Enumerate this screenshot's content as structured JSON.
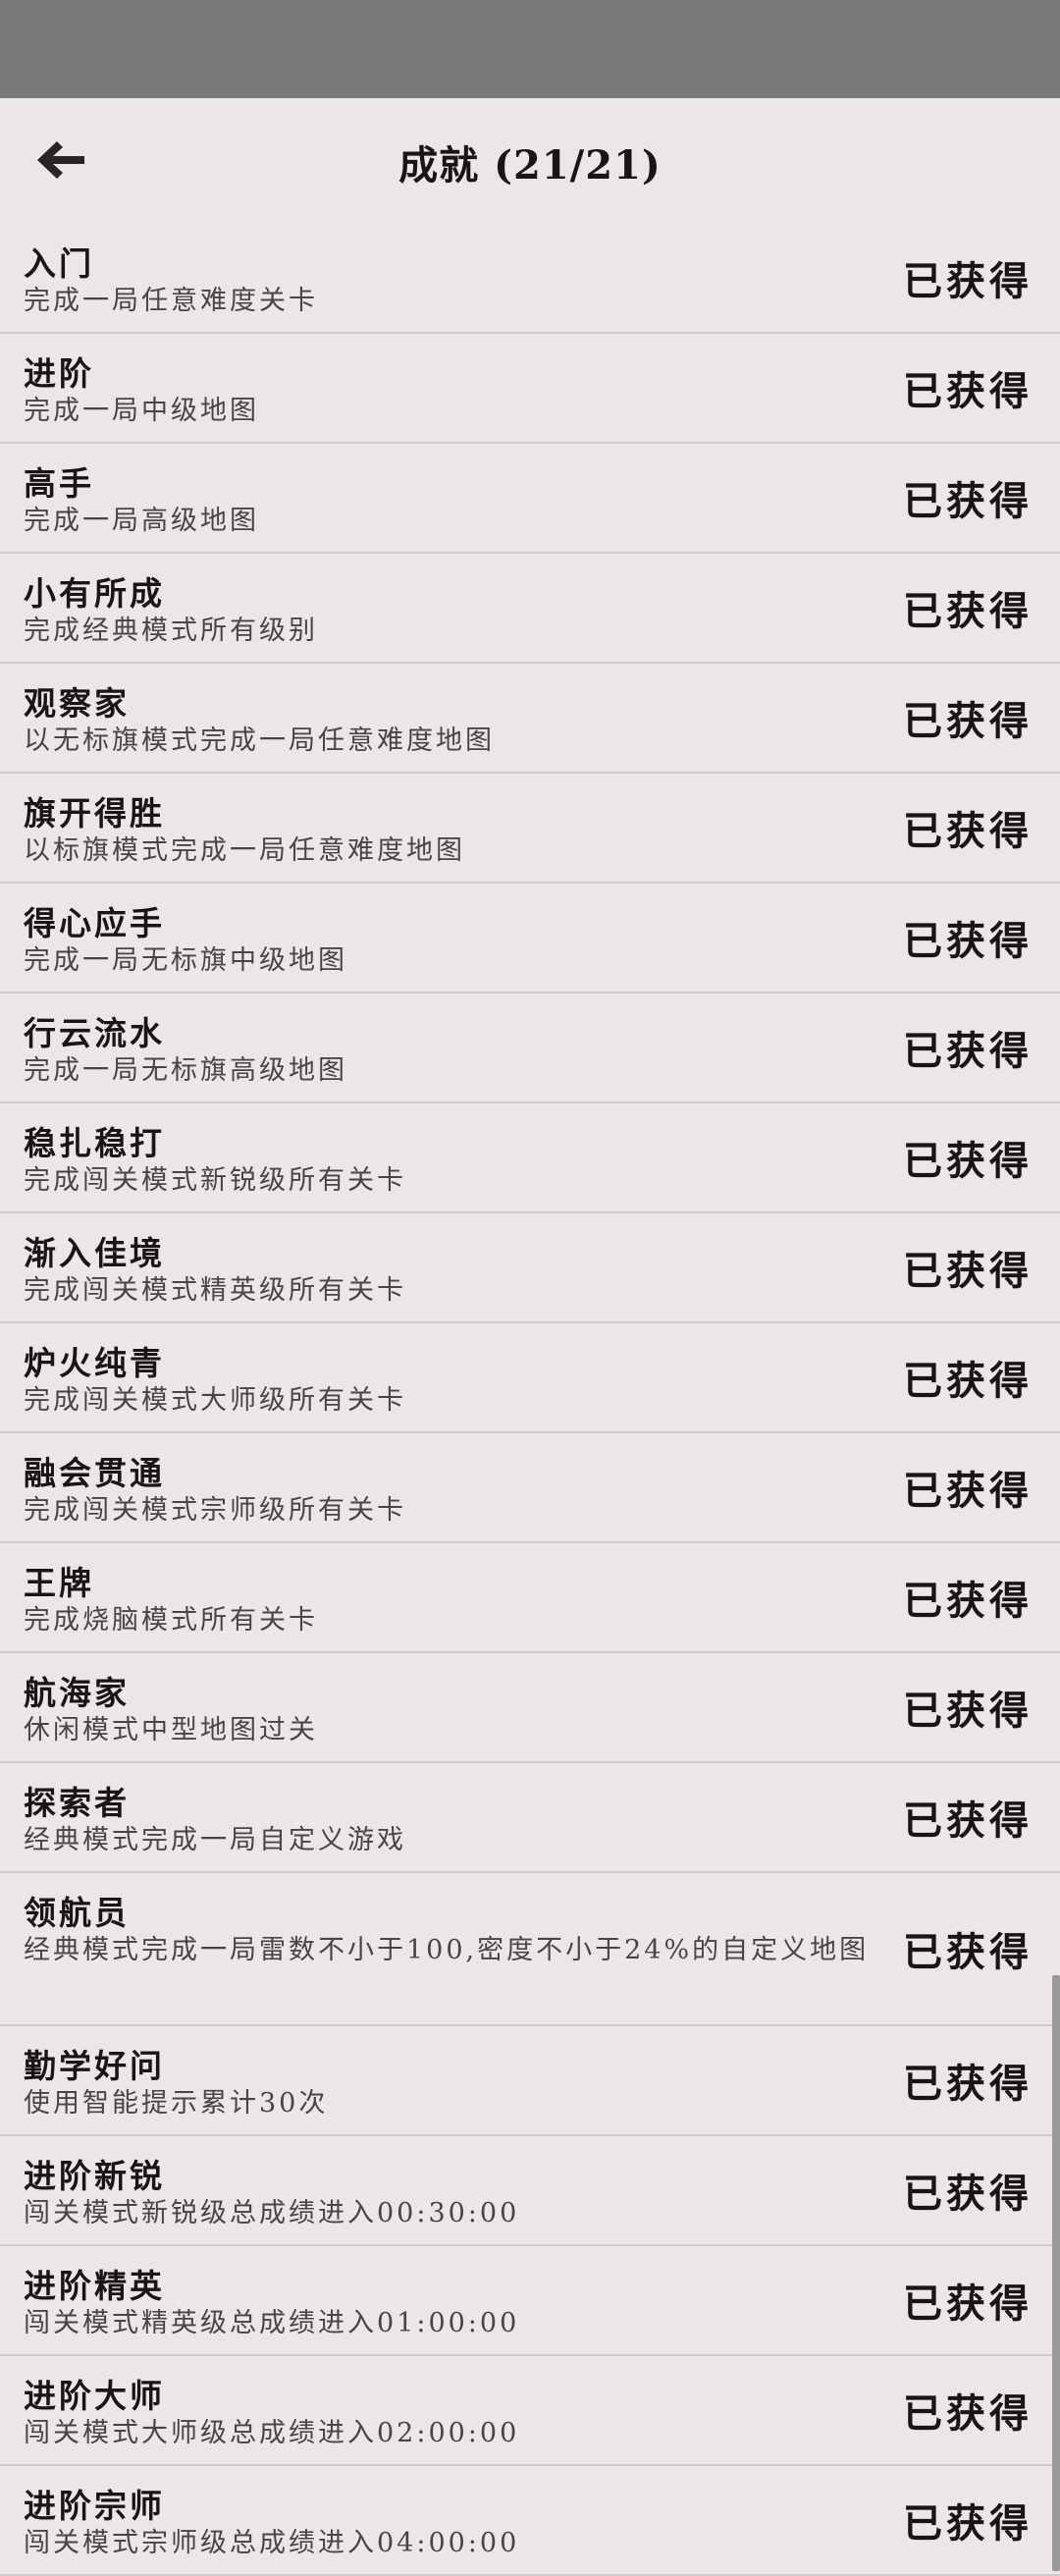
{
  "header": {
    "back_icon": "arrow-left-icon",
    "title": "成就 (21/21)"
  },
  "achievements": [
    {
      "name": "入门",
      "desc": "完成一局任意难度关卡",
      "status": "已获得"
    },
    {
      "name": "进阶",
      "desc": "完成一局中级地图",
      "status": "已获得"
    },
    {
      "name": "高手",
      "desc": "完成一局高级地图",
      "status": "已获得"
    },
    {
      "name": "小有所成",
      "desc": "完成经典模式所有级别",
      "status": "已获得"
    },
    {
      "name": "观察家",
      "desc": "以无标旗模式完成一局任意难度地图",
      "status": "已获得"
    },
    {
      "name": "旗开得胜",
      "desc": "以标旗模式完成一局任意难度地图",
      "status": "已获得"
    },
    {
      "name": "得心应手",
      "desc": "完成一局无标旗中级地图",
      "status": "已获得"
    },
    {
      "name": "行云流水",
      "desc": "完成一局无标旗高级地图",
      "status": "已获得"
    },
    {
      "name": "稳扎稳打",
      "desc": "完成闯关模式新锐级所有关卡",
      "status": "已获得"
    },
    {
      "name": "渐入佳境",
      "desc": "完成闯关模式精英级所有关卡",
      "status": "已获得"
    },
    {
      "name": "炉火纯青",
      "desc": "完成闯关模式大师级所有关卡",
      "status": "已获得"
    },
    {
      "name": "融会贯通",
      "desc": "完成闯关模式宗师级所有关卡",
      "status": "已获得"
    },
    {
      "name": "王牌",
      "desc": "完成烧脑模式所有关卡",
      "status": "已获得"
    },
    {
      "name": "航海家",
      "desc": "休闲模式中型地图过关",
      "status": "已获得"
    },
    {
      "name": "探索者",
      "desc": "经典模式完成一局自定义游戏",
      "status": "已获得"
    },
    {
      "name": "领航员",
      "desc": "经典模式完成一局雷数不小于100,密度不小于24%的自定义地图",
      "status": "已获得"
    },
    {
      "name": "勤学好问",
      "desc": "使用智能提示累计30次",
      "status": "已获得"
    },
    {
      "name": "进阶新锐",
      "desc": "闯关模式新锐级总成绩进入00:30:00",
      "status": "已获得"
    },
    {
      "name": "进阶精英",
      "desc": "闯关模式精英级总成绩进入01:00:00",
      "status": "已获得"
    },
    {
      "name": "进阶大师",
      "desc": "闯关模式大师级总成绩进入02:00:00",
      "status": "已获得"
    },
    {
      "name": "进阶宗师",
      "desc": "闯关模式宗师级总成绩进入04:00:00",
      "status": "已获得"
    }
  ],
  "colors": {
    "background": "#ebe7e7",
    "status_bar": "#7a7a7a",
    "divider": "#cfcbcb",
    "text_primary": "#1a1414",
    "text_secondary": "#4a4444"
  }
}
